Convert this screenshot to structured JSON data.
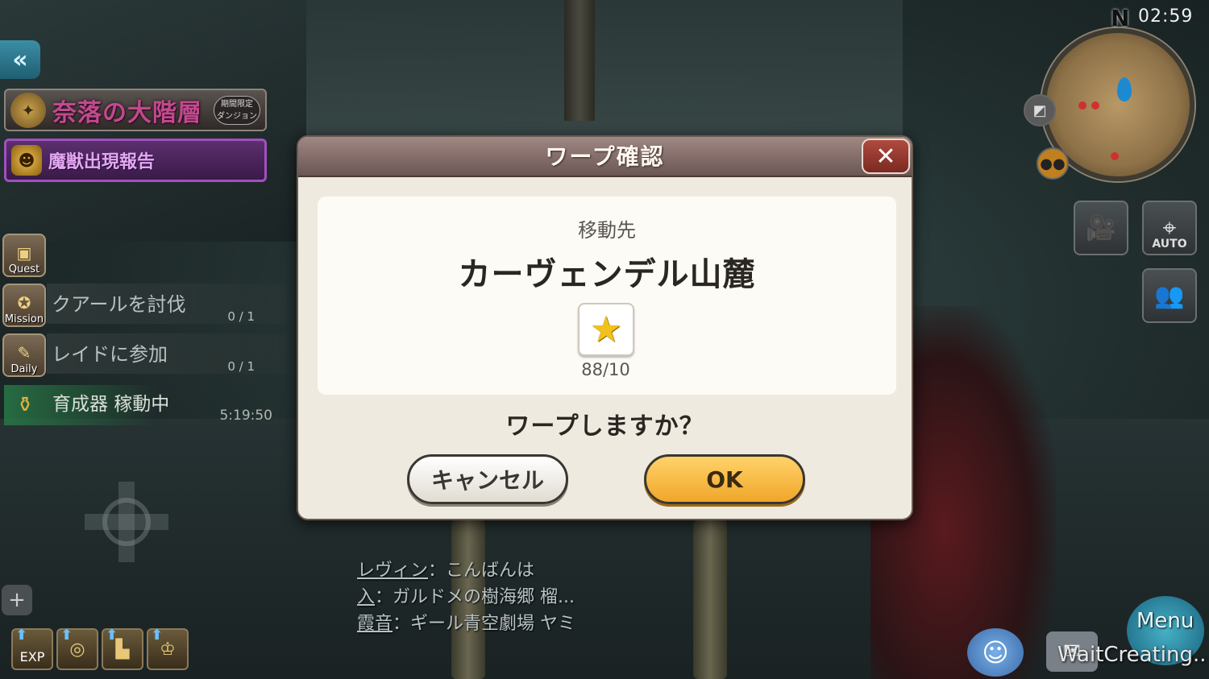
{
  "left_panel": {
    "event_title": "奈落の大階層",
    "event_limited": "期間限定\nダンジョン",
    "report_label": "魔獣出現報告",
    "quests": [
      {
        "icon_caption": "Quest",
        "name": "",
        "count": ""
      },
      {
        "icon_caption": "Mission",
        "name": "クアールを討伐",
        "count": "0 / 1"
      },
      {
        "icon_caption": "Daily",
        "name": "レイドに参加",
        "count": "0 / 1"
      }
    ],
    "breeder": {
      "name": "育成器 稼動中",
      "timer": "5:19:50"
    },
    "tool_buttons": [
      {
        "name": "exp",
        "caption": "EXP"
      },
      {
        "name": "disc",
        "caption": ""
      },
      {
        "name": "boot",
        "caption": ""
      },
      {
        "name": "crown",
        "caption": ""
      }
    ]
  },
  "hud": {
    "clock": "02:59",
    "compass": "N",
    "auto_label": "AUTO"
  },
  "chat": [
    {
      "speaker": "レヴィン",
      "message": "こんばんは"
    },
    {
      "speaker": "入",
      "message": "ガルドメの樹海郷 榴..."
    },
    {
      "speaker": "霞音",
      "message": "ギール青空劇場 ヤミ"
    }
  ],
  "bottom_right": {
    "menu_label": "Menu",
    "status_text": "WaitCreating.."
  },
  "dialog": {
    "title": "ワープ確認",
    "destination_label": "移動先",
    "destination_name": "カーヴェンデル山麓",
    "star_count": "88/10",
    "question": "ワープしますか？",
    "cancel_label": "キャンセル",
    "ok_label": "OK"
  },
  "colors": {
    "ok_button": "#f0a62a",
    "dialog_header": "#6a5654",
    "report_border": "#a050c0",
    "breeder_highlight": "#287846"
  }
}
